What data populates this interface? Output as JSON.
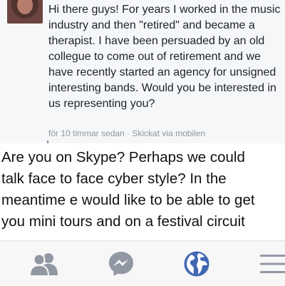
{
  "message": {
    "text": "Hi there guys! For years I worked in the music industry and then \"retired\" and became a therapist. I have been persuaded by an old collegue to come out of retirement and we have recently started an agency for unsigned interesting bands. Would you be interested in us representing you?",
    "time": "för 10 timmar sedan",
    "separator": " · ",
    "sent_via": "Skickat via mobilen"
  },
  "overlay": {
    "lines": [
      "Are you on Skype? Perhaps we could",
      "talk face to face cyber style? In the",
      "meantime e would like to be able to get",
      "you mini tours and on a festival circuit"
    ]
  },
  "tabbar": {
    "tabs": [
      {
        "icon": "friends-icon",
        "active": false
      },
      {
        "icon": "messenger-icon",
        "active": false
      },
      {
        "icon": "globe-icon",
        "active": true
      },
      {
        "icon": "menu-icon",
        "active": false
      }
    ]
  },
  "colors": {
    "text": "#1d2129",
    "meta": "#90949c",
    "icon_inactive": "#9197a3",
    "icon_active": "#4267b2",
    "panel": "#f6f7f9",
    "tabbar": "#f7f7f7"
  }
}
